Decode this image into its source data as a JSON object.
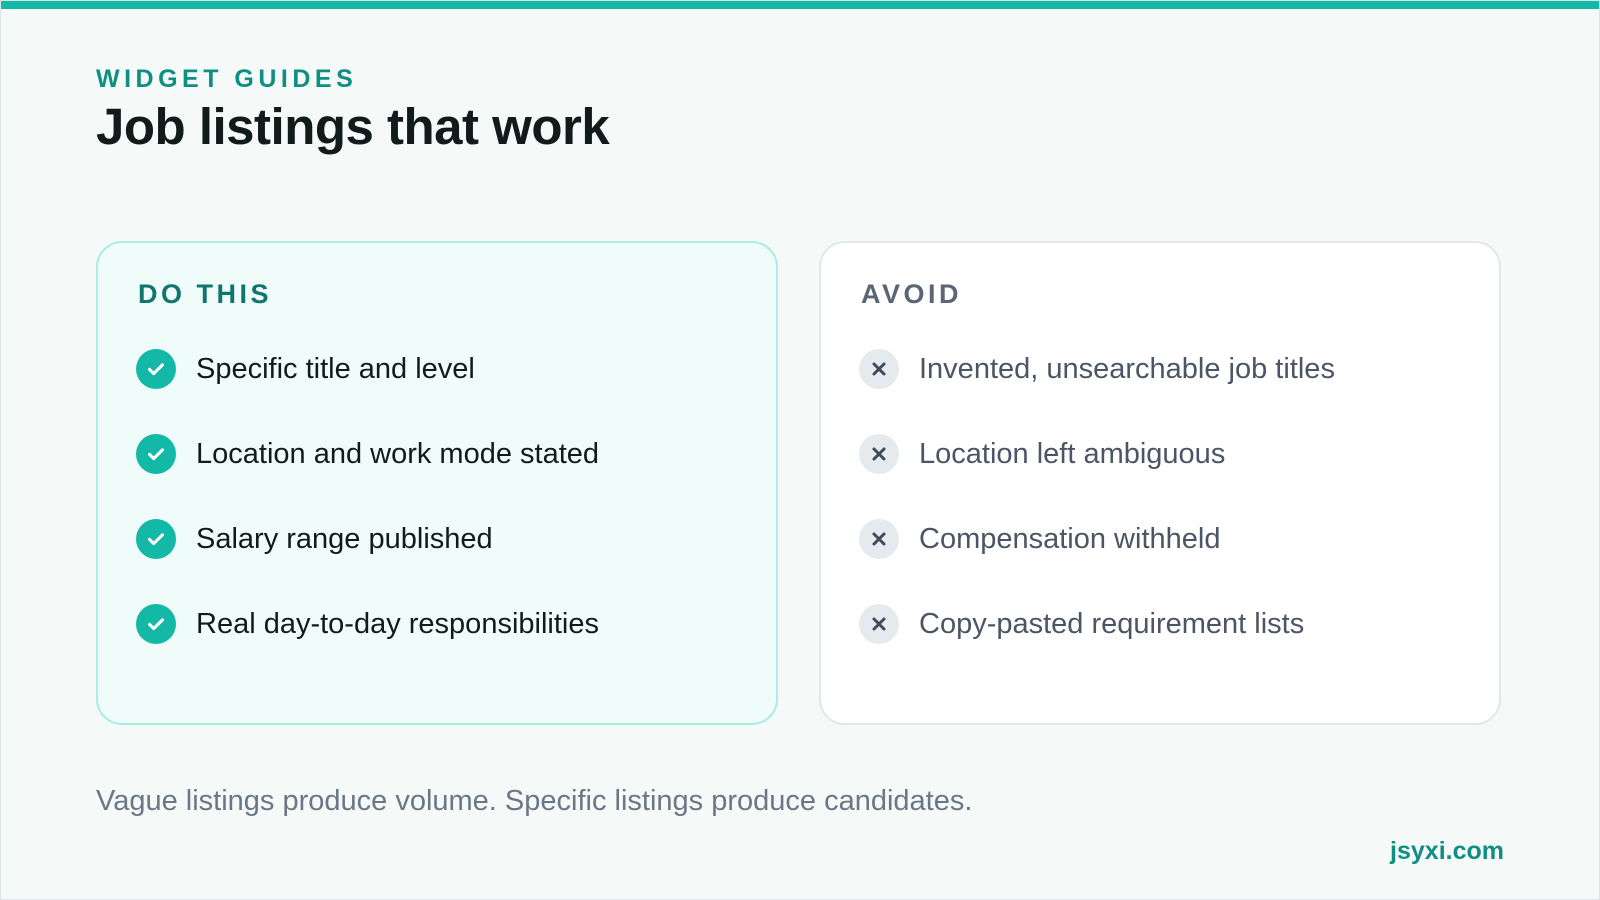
{
  "header": {
    "eyebrow": "WIDGET GUIDES",
    "title": "Job listings that work"
  },
  "do_card": {
    "heading": "DO THIS",
    "icon": "check-icon",
    "items": [
      "Specific title and level",
      "Location and work mode stated",
      "Salary range published",
      "Real day-to-day responsibilities"
    ]
  },
  "avoid_card": {
    "heading": "AVOID",
    "icon": "x-icon",
    "items": [
      "Invented, unsearchable job titles",
      "Location left ambiguous",
      "Compensation withheld",
      "Copy-pasted requirement lists"
    ]
  },
  "footer": {
    "note": "Vague listings produce volume. Specific listings produce candidates.",
    "brand": "jsyxi.com"
  },
  "colors": {
    "accent": "#14b8a6",
    "accent_dark": "#0f766e",
    "do_background": "#effcf9",
    "avoid_icon_background": "#e5eaee"
  }
}
